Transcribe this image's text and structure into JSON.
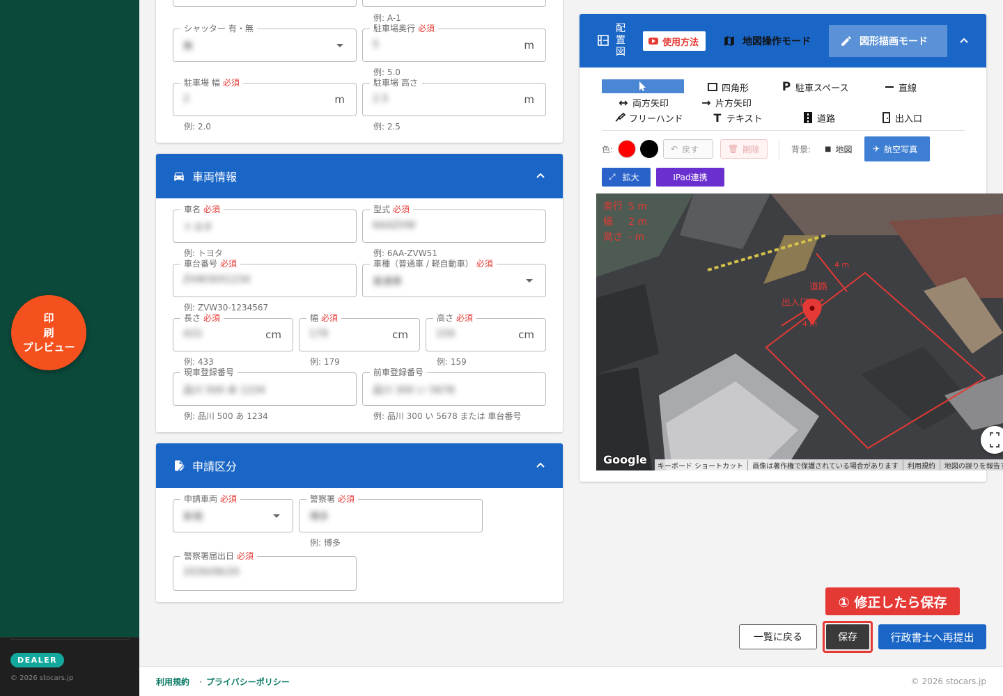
{
  "sidebar": {
    "print_preview_line1": "印刷",
    "print_preview_line2": "プレビュー",
    "badge": "DEALER",
    "copyright": "© 2026 stocars.jp"
  },
  "parking": {
    "shutter": {
      "label": "シャッター 有・無",
      "value": "無"
    },
    "depth": {
      "label": "駐車場奥行",
      "required": "必須",
      "value": "5",
      "unit": "m",
      "hint_above": "例: A-1",
      "hint": "例: 5.0"
    },
    "width": {
      "label": "駐車場 幅",
      "required": "必須",
      "value": "2",
      "unit": "m",
      "hint": "例: 2.0"
    },
    "height": {
      "label": "駐車場 高さ",
      "value": "2.5",
      "unit": "m",
      "hint": "例: 2.5"
    }
  },
  "vehicle": {
    "title": "車両情報",
    "name": {
      "label": "車名",
      "required": "必須",
      "value": "トヨタ",
      "hint": "例: トヨタ"
    },
    "model": {
      "label": "型式",
      "required": "必須",
      "value": "6AAZVW",
      "hint": "例: 6AA-ZVW51"
    },
    "chassis": {
      "label": "車台番号",
      "required": "必須",
      "value": "ZVW30X1234",
      "hint": "例: ZVW30-1234567"
    },
    "type": {
      "label": "車種（普通車 / 軽自動車）",
      "required": "必須",
      "value": "普通車"
    },
    "length": {
      "label": "長さ",
      "required": "必須",
      "value": "433",
      "unit": "cm",
      "hint": "例: 433"
    },
    "vwidth": {
      "label": "幅",
      "required": "必須",
      "value": "179",
      "unit": "cm",
      "hint": "例: 179"
    },
    "vheight": {
      "label": "高さ",
      "required": "必須",
      "value": "159",
      "unit": "cm",
      "hint": "例: 159"
    },
    "current_reg": {
      "label": "現車登録番号",
      "value": "品川 500 あ 1234",
      "hint": "例: 品川 500 あ 1234"
    },
    "prev_reg": {
      "label": "前車登録番号",
      "value": "品川 300 い 5678",
      "hint": "例: 品川 300 い 5678 または 車台番号"
    }
  },
  "application": {
    "title": "申請区分",
    "vehicle_kind": {
      "label": "申請車両",
      "required": "必須",
      "value": "新規"
    },
    "police": {
      "label": "警察署",
      "required": "必須",
      "value": "博多",
      "hint": "例: 博多"
    },
    "date": {
      "label": "警察署届出日",
      "required": "必須",
      "value": "2026/06/20"
    }
  },
  "map_panel": {
    "title": "配置図",
    "howto": "使用方法",
    "mode_map": "地図操作モード",
    "mode_draw": "図形描画モード",
    "tools": {
      "rect": "四角形",
      "parking": "駐車スペース",
      "line": "直線",
      "both_arrow": "両方矢印",
      "one_arrow": "片方矢印",
      "freehand": "フリーハンド",
      "text": "テキスト",
      "road": "道路",
      "entrance": "出入口"
    },
    "color_label": "色:",
    "colors": [
      "#ff0000",
      "#000000"
    ],
    "undo": "戻す",
    "delete": "削除",
    "bg_label": "背景:",
    "bg_map": "地図",
    "bg_aerial": "航空写真",
    "expand": "拡大",
    "ipad": "IPad連携",
    "dims": {
      "depth_label": "奥行",
      "depth_value": "5 m",
      "width_label": "幅",
      "width_value": "2 m",
      "height_label": "高さ",
      "height_value": "- m"
    },
    "annotations": {
      "len_top": "4 m",
      "road": "道路",
      "entrance": "出入口",
      "len_mid": "4 m"
    },
    "google": "Google",
    "attribution": [
      "キーボード ショートカット",
      "画像は著作権で保護されている場合があります",
      "利用規約",
      "地図の誤りを報告す"
    ]
  },
  "actions": {
    "callout": "① 修正したら保存",
    "back": "一覧に戻る",
    "save": "保存",
    "resubmit": "行政書士へ再提出"
  },
  "footer": {
    "terms": "利用規約",
    "sep": "・",
    "privacy": "プライバシーポリシー",
    "copyright": "© 2026 stocars.jp"
  }
}
